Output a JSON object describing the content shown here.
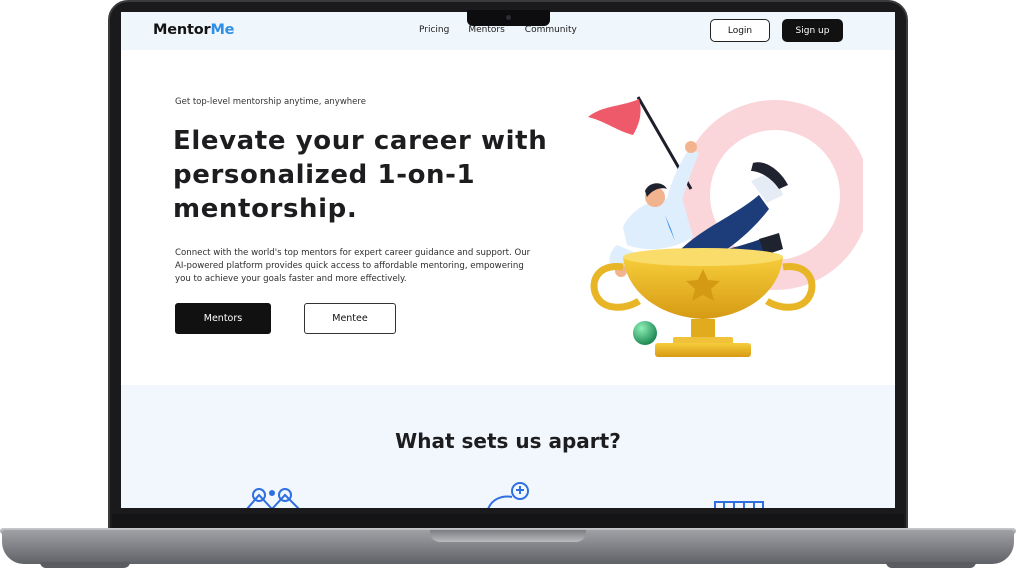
{
  "nav": {
    "logo_main": "Mentor",
    "logo_accent": "Me",
    "links": [
      "Pricing",
      "Mentors",
      "Community"
    ],
    "login": "Login",
    "signup": "Sign up"
  },
  "hero": {
    "tagline": "Get top-level mentorship anytime, anywhere",
    "headline": "Elevate your career with personalized 1-on-1 mentorship.",
    "description": "Connect with the world's top mentors for expert career guidance and support. Our AI-powered platform provides quick access to affordable mentoring, empowering you to achieve your goals faster and more effectively.",
    "btn_mentors": "Mentors",
    "btn_mentee": "Mentee"
  },
  "features": {
    "title": "What sets us apart?",
    "icons": [
      "network-icon",
      "lightbulb-icon",
      "grid-icon"
    ]
  },
  "colors": {
    "accent": "#2f8fe6",
    "nav_bg": "#eff6fc",
    "features_bg": "#f1f7fd",
    "dark_button": "#111111",
    "flag": "#ef5a6a",
    "trophy": "#e8b526"
  }
}
